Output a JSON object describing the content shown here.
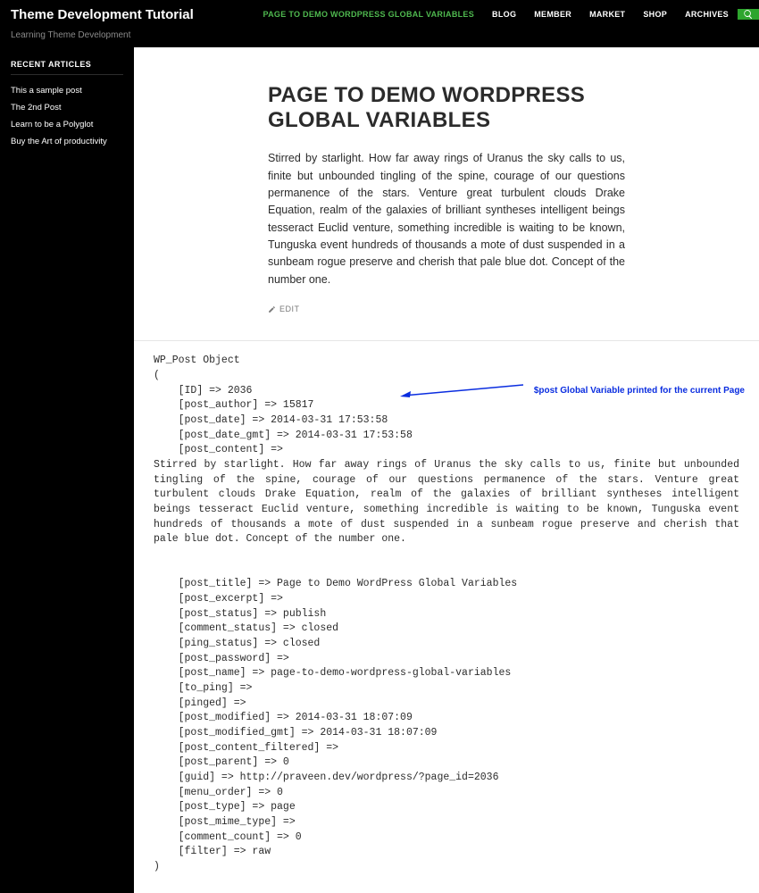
{
  "site": {
    "title": "Theme Development Tutorial",
    "tagline": "Learning Theme Development"
  },
  "nav": {
    "items": [
      {
        "label": "PAGE TO DEMO WORDPRESS GLOBAL VARIABLES",
        "active": true
      },
      {
        "label": "BLOG",
        "active": false
      },
      {
        "label": "MEMBER",
        "active": false
      },
      {
        "label": "MARKET",
        "active": false
      },
      {
        "label": "SHOP",
        "active": false
      },
      {
        "label": "ARCHIVES",
        "active": false
      }
    ]
  },
  "sidebar": {
    "widget_title": "RECENT ARTICLES",
    "items": [
      "This a sample post",
      "The 2nd Post",
      "Learn to be a Polyglot",
      "Buy the Art of productivity"
    ]
  },
  "article": {
    "title": "PAGE TO DEMO WORDPRESS GLOBAL VARIABLES",
    "body": "Stirred by starlight. How far away rings of Uranus the sky calls to us, finite but unbounded tingling of the spine, courage of our questions permanence of the stars. Venture great turbulent clouds Drake Equation, realm of the galaxies of brilliant syntheses intelligent beings tesseract Euclid venture, something incredible is waiting to be known, Tunguska event hundreds of thousands a mote of dust suspended in a sunbeam rogue preserve and cherish that pale blue dot. Concept of the number one.",
    "edit_label": "EDIT"
  },
  "annotation": {
    "text": "$post Global Variable printed for the current Page"
  },
  "dump": "WP_Post Object\n(\n    [ID] => 2036\n    [post_author] => 15817\n    [post_date] => 2014-03-31 17:53:58\n    [post_date_gmt] => 2014-03-31 17:53:58\n    [post_content] =>\nStirred by starlight. How far away rings of Uranus the sky calls to us, finite but unbounded tingling of the spine, courage of our questions permanence of the stars. Venture great turbulent clouds Drake Equation, realm of the galaxies of brilliant syntheses intelligent beings tesseract Euclid venture, something incredible is waiting to be known, Tunguska event hundreds of thousands a mote of dust suspended in a sunbeam rogue preserve and cherish that pale blue dot. Concept of the number one.\n\n\n    [post_title] => Page to Demo WordPress Global Variables\n    [post_excerpt] =>\n    [post_status] => publish\n    [comment_status] => closed\n    [ping_status] => closed\n    [post_password] =>\n    [post_name] => page-to-demo-wordpress-global-variables\n    [to_ping] =>\n    [pinged] =>\n    [post_modified] => 2014-03-31 18:07:09\n    [post_modified_gmt] => 2014-03-31 18:07:09\n    [post_content_filtered] =>\n    [post_parent] => 0\n    [guid] => http://praveen.dev/wordpress/?page_id=2036\n    [menu_order] => 0\n    [post_type] => page\n    [post_mime_type] =>\n    [comment_count] => 0\n    [filter] => raw\n)"
}
